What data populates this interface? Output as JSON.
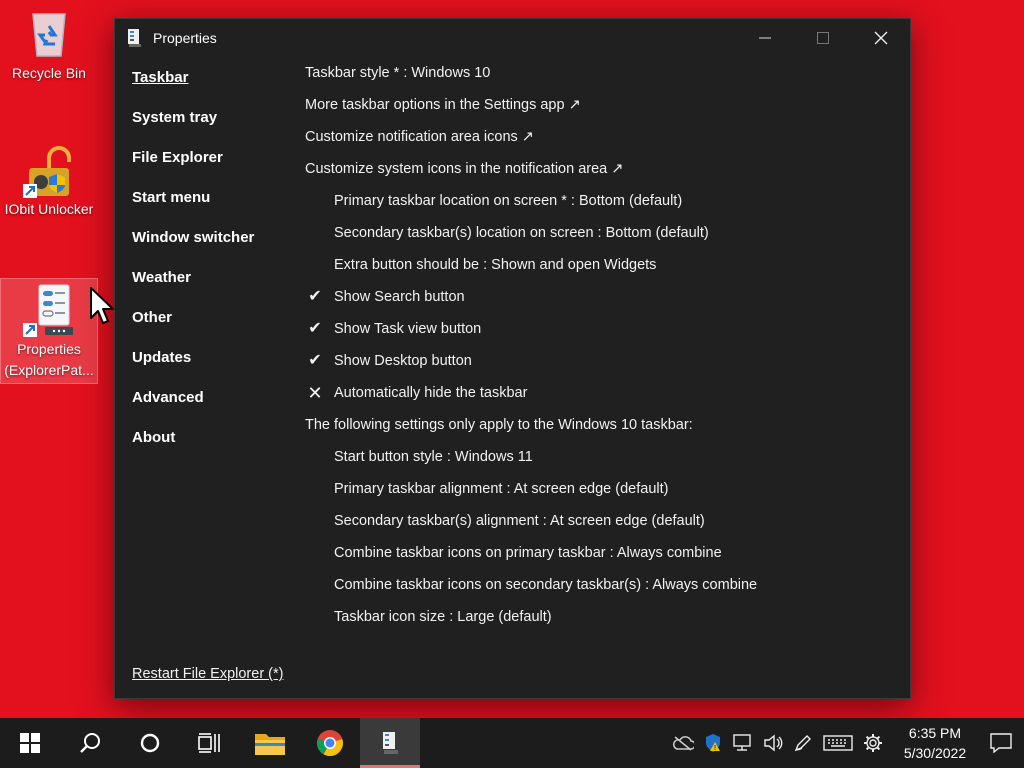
{
  "desktop": {
    "icons": [
      {
        "label": "Recycle Bin"
      },
      {
        "label": "IObit Unlocker"
      },
      {
        "label": "Properties (ExplorerPat..."
      }
    ]
  },
  "window": {
    "title": "Properties",
    "sidebar": [
      {
        "label": "Taskbar",
        "active": true
      },
      {
        "label": "System tray"
      },
      {
        "label": "File Explorer"
      },
      {
        "label": "Start menu"
      },
      {
        "label": "Window switcher"
      },
      {
        "label": "Weather"
      },
      {
        "label": "Other"
      },
      {
        "label": "Updates"
      },
      {
        "label": "Advanced"
      },
      {
        "label": "About"
      }
    ],
    "settings": [
      {
        "text": "Taskbar style * : Windows 10"
      },
      {
        "text": "More taskbar options in the Settings app ↗"
      },
      {
        "text": "Customize notification area icons ↗"
      },
      {
        "text": "Customize system icons in the notification area ↗"
      },
      {
        "text": "Primary taskbar location on screen * : Bottom (default)"
      },
      {
        "text": "Secondary taskbar(s) location on screen : Bottom (default)"
      },
      {
        "text": "Extra button should be : Shown and open Widgets"
      },
      {
        "text": "Show Search button",
        "mark": "✔"
      },
      {
        "text": "Show Task view button",
        "mark": "✔"
      },
      {
        "text": "Show Desktop button",
        "mark": "✔"
      },
      {
        "text": "Automatically hide the taskbar",
        "mark": "✕"
      },
      {
        "text": "The following settings only apply to the Windows 10 taskbar:"
      },
      {
        "text": "Start button style : Windows 11"
      },
      {
        "text": "Primary taskbar alignment : At screen edge (default)"
      },
      {
        "text": "Secondary taskbar(s) alignment : At screen edge (default)"
      },
      {
        "text": "Combine taskbar icons on primary taskbar : Always combine"
      },
      {
        "text": "Combine taskbar icons on secondary taskbar(s) : Always combine"
      },
      {
        "text": "Taskbar icon size : Large (default)"
      }
    ],
    "restart_label": "Restart File Explorer (*)"
  },
  "taskbar": {
    "time": "6:35 PM",
    "date": "5/30/2022"
  }
}
